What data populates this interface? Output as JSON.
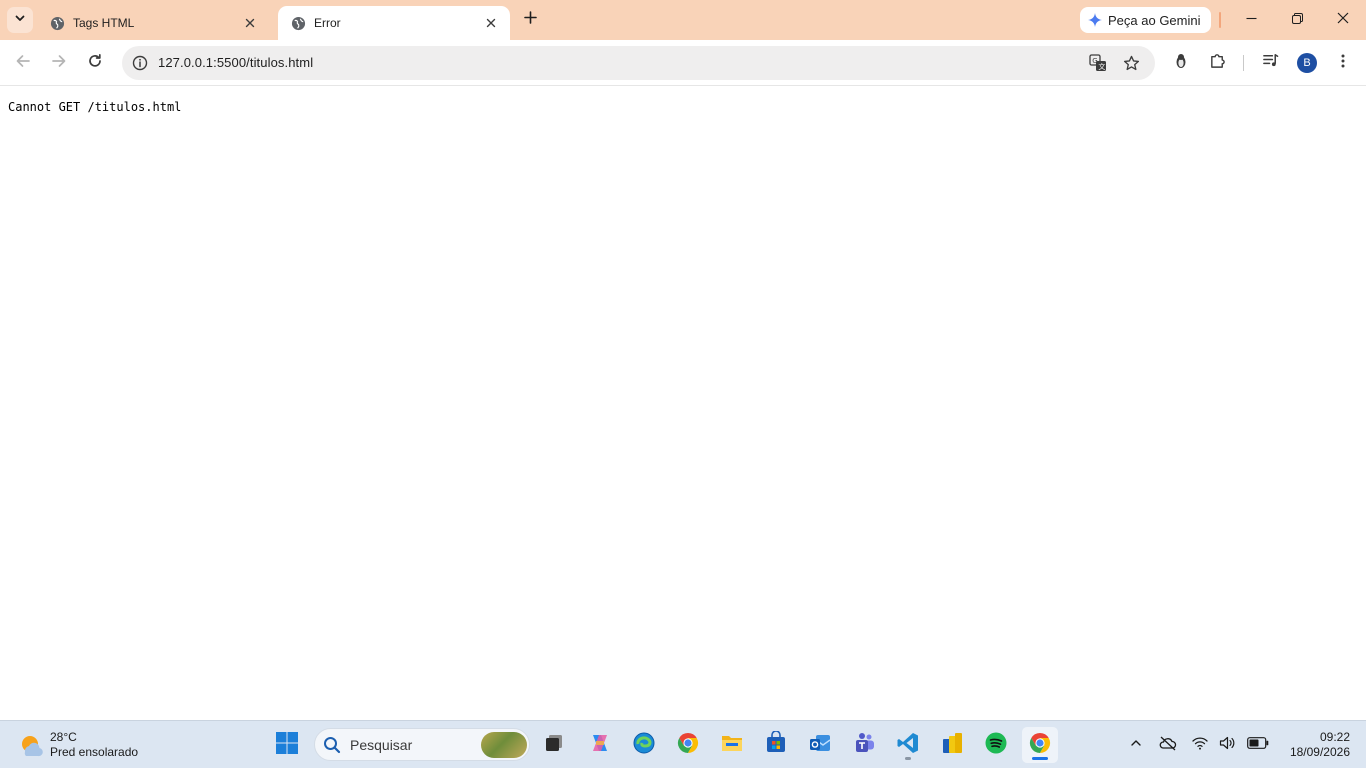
{
  "browser": {
    "tabs": [
      {
        "title": "Tags HTML",
        "active": false
      },
      {
        "title": "Error",
        "active": true
      }
    ],
    "gemini_label": "Peça ao Gemini",
    "url": "127.0.0.1:5500/titulos.html",
    "profile_initial": "B"
  },
  "page": {
    "error_message": "Cannot GET /titulos.html"
  },
  "taskbar": {
    "weather": {
      "temperature": "28°C",
      "condition": "Pred ensolarado"
    },
    "search_placeholder": "Pesquisar",
    "clock": {
      "time": "09:22",
      "date": "18/09/2026"
    }
  },
  "colors": {
    "tabstrip": "#f9d3b8",
    "accent": "#1a73e8",
    "taskbar": "#dce6f2"
  }
}
